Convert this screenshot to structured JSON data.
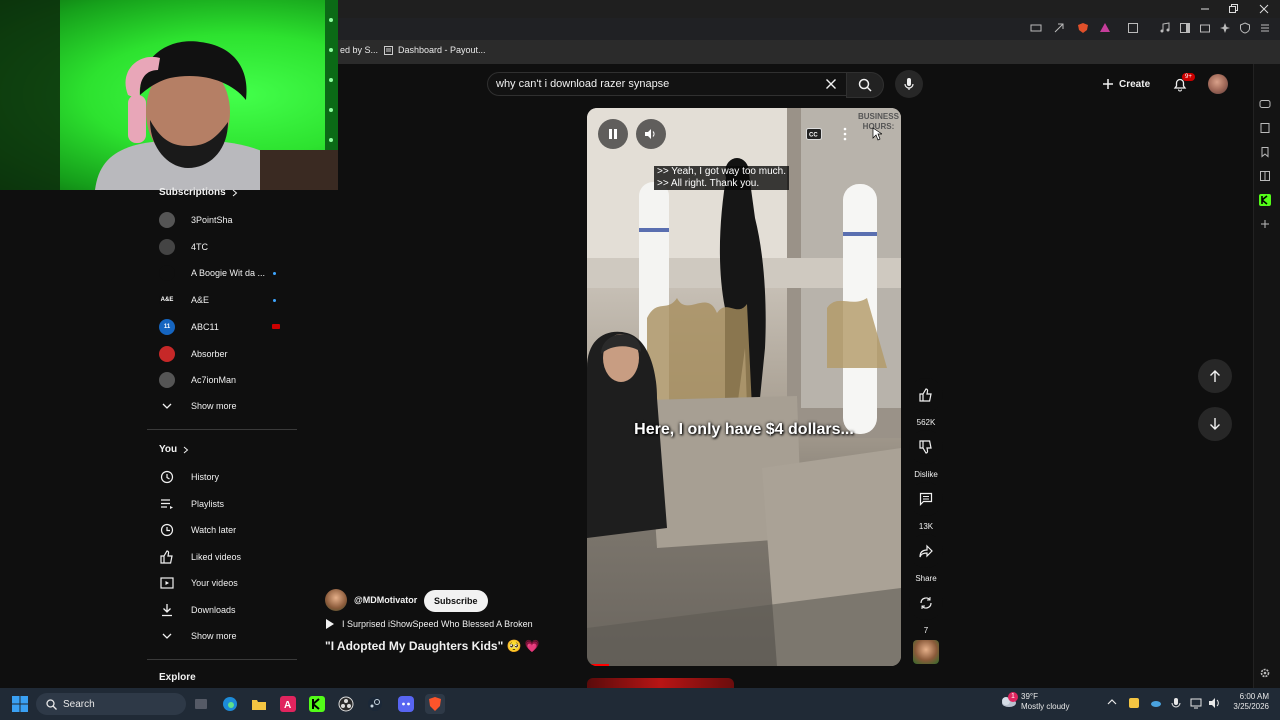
{
  "browser": {
    "bookmarks": [
      "ed by S...",
      "Dashboard - Payout..."
    ],
    "colors": {
      "frame": "#1f1f1f",
      "bookmarks_bar": "#2b2b2b"
    }
  },
  "youtube": {
    "search_value": "why can't i download razer synapse",
    "create_label": "Create",
    "notification_badge": "9+",
    "subscriptions_title": "Subscriptions",
    "subscriptions": [
      {
        "name": "3PointSha",
        "indicator": "none",
        "color": "#555555",
        "initials": ""
      },
      {
        "name": "4TC",
        "indicator": "none",
        "color": "#444444",
        "initials": ""
      },
      {
        "name": "A Boogie Wit da ...",
        "indicator": "dot",
        "color": "#0f0f0f",
        "initials": ""
      },
      {
        "name": "A&E",
        "indicator": "dot",
        "color": "#0f0f0f",
        "initials": "A&E"
      },
      {
        "name": "ABC11",
        "indicator": "live",
        "color": "#1565c0",
        "initials": "11"
      },
      {
        "name": "Absorber",
        "indicator": "none",
        "color": "#c62828",
        "initials": ""
      },
      {
        "name": "Ac7ionMan",
        "indicator": "none",
        "color": "#555555",
        "initials": ""
      }
    ],
    "show_more_1": "Show more",
    "you_title": "You",
    "you_items": [
      {
        "label": "History",
        "icon": "history-icon"
      },
      {
        "label": "Playlists",
        "icon": "playlists-icon"
      },
      {
        "label": "Watch later",
        "icon": "watch-later-icon"
      },
      {
        "label": "Liked videos",
        "icon": "liked-videos-icon"
      },
      {
        "label": "Your videos",
        "icon": "your-videos-icon"
      },
      {
        "label": "Downloads",
        "icon": "downloads-icon"
      }
    ],
    "show_more_2": "Show more",
    "explore_title": "Explore",
    "video": {
      "caption_line1": ">> Yeah, I got way too much.",
      "caption_line2": ">> All right. Thank you.",
      "big_caption": "Here, I only have $4 dollars...",
      "sign_line1": "BUSINESS",
      "sign_line2": "HOURS:",
      "progress": 0.07
    },
    "actions": {
      "like_count": "562K",
      "dislike_label": "Dislike",
      "comment_count": "13K",
      "share_label": "Share",
      "remix_count": "7"
    },
    "channel": {
      "handle": "@MDMotivator",
      "subscribe_label": "Subscribe",
      "related_video": "I Surprised iShowSpeed Who Blessed A Broken",
      "title": "\"I Adopted My Daughters Kids\" 🥺 💗"
    },
    "accent_color": "#ff0000"
  },
  "taskbar": {
    "search_label": "Search",
    "weather_temp": "39°F",
    "weather_desc": "Mostly cloudy",
    "weather_badge": "1",
    "time": "6:00 AM",
    "date": "3/25/2026"
  }
}
